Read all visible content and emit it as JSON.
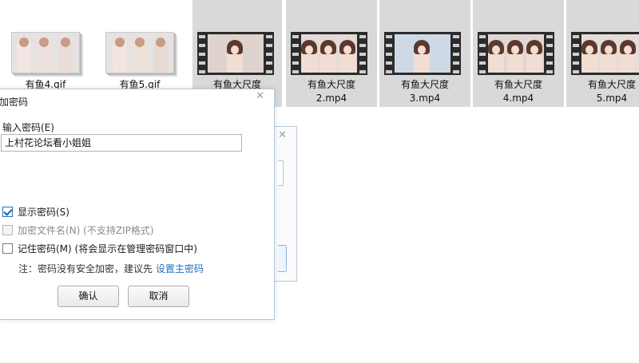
{
  "files": [
    {
      "name": "有鱼4.gif",
      "kind": "gif",
      "selected": false
    },
    {
      "name": "有鱼5.gif",
      "kind": "gif",
      "selected": false
    },
    {
      "name": "有鱼大尺度",
      "kind": "video",
      "selected": true
    },
    {
      "name": "有鱼大尺度\n2.mp4",
      "kind": "video",
      "selected": true
    },
    {
      "name": "有鱼大尺度\n3.mp4",
      "kind": "video",
      "selected": true
    },
    {
      "name": "有鱼大尺度\n4.mp4",
      "kind": "video",
      "selected": true
    },
    {
      "name": "有鱼大尺度\n5.mp4",
      "kind": "video",
      "selected": true
    }
  ],
  "dialog": {
    "title": "加密码",
    "close_icon": "✕",
    "password_label": "输入密码(E)",
    "password_value": "上村花论坛看小姐姐",
    "options": {
      "show_password": {
        "label": "显示密码(S)",
        "checked": true,
        "enabled": true
      },
      "encrypt_filenames": {
        "label": "加密文件名(N) (不支持ZIP格式)",
        "checked": false,
        "enabled": false
      },
      "remember_password": {
        "label": "记住密码(M) (将会显示在管理密码窗口中)",
        "checked": false,
        "enabled": true
      }
    },
    "note_prefix": "注：密码没有安全加密，建议先",
    "note_link": "设置主密码",
    "ok_label": "确认",
    "cancel_label": "取消"
  },
  "back_dialog": {
    "close_icon": "✕"
  },
  "colors": {
    "accent": "#1f6fbf",
    "selection": "#d9d9d9",
    "border": "#b5c9dc"
  }
}
